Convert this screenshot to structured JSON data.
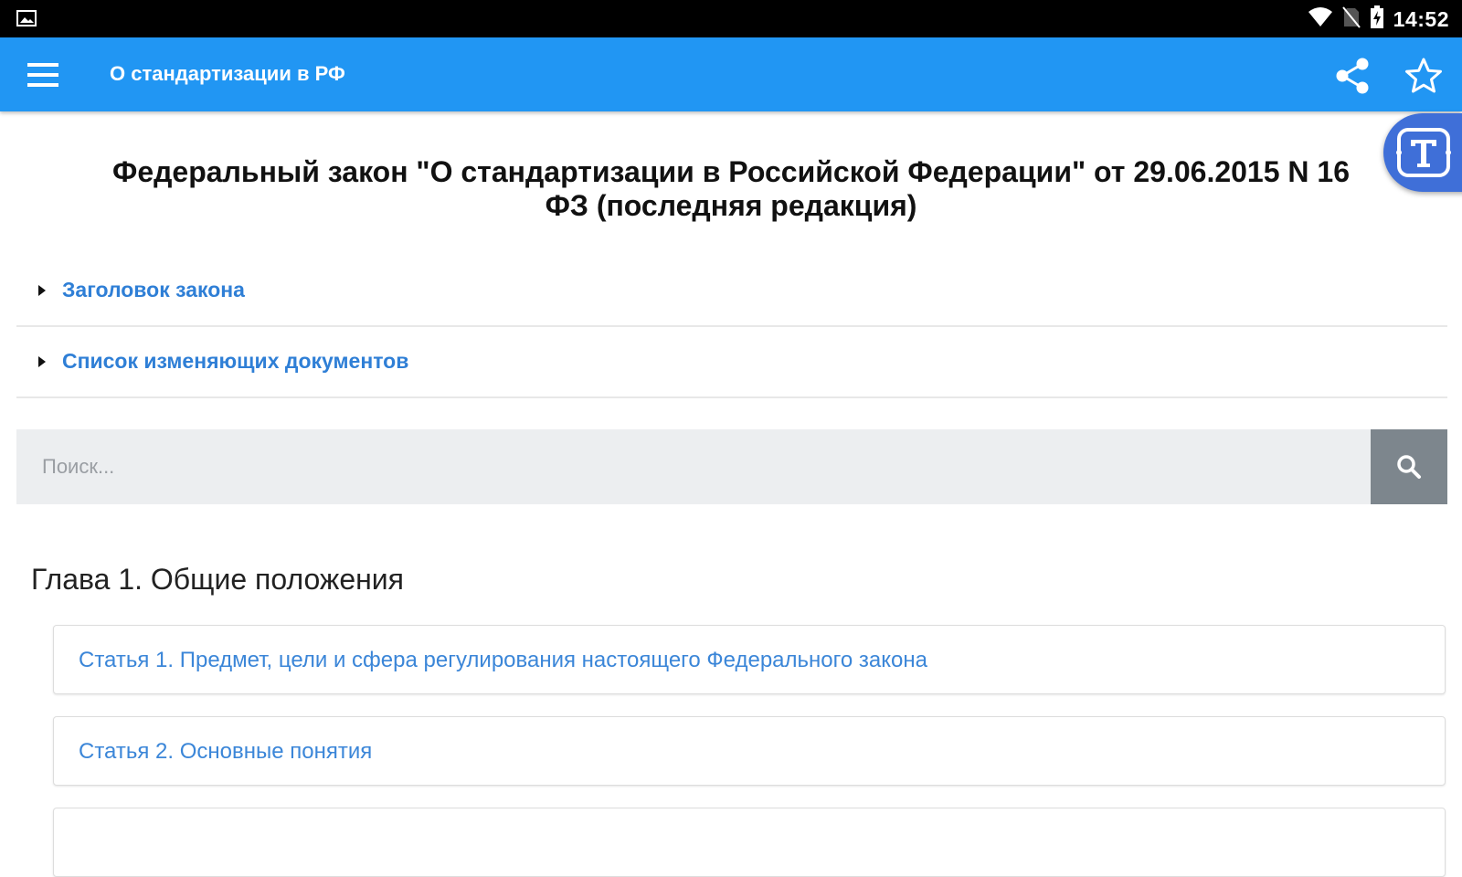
{
  "status_bar": {
    "time": "14:52",
    "icons": [
      "image-notification-icon",
      "wifi-icon",
      "no-sim-icon",
      "battery-charging-icon"
    ]
  },
  "app_bar": {
    "title": "О стандартизации в РФ",
    "icons": [
      "menu-icon",
      "share-icon",
      "star-icon"
    ]
  },
  "floating_button": {
    "icon": "translate-text-icon"
  },
  "document": {
    "title": "Федеральный закон \"О стандартизации в Российской Федерации\" от 29.06.2015 N 16\nФЗ (последняя редакция)"
  },
  "expanders": [
    {
      "label": "Заголовок закона"
    },
    {
      "label": "Список изменяющих документов"
    }
  ],
  "search": {
    "placeholder": "Поиск...",
    "icon": "search-icon"
  },
  "chapter": {
    "title": "Глава 1. Общие положения",
    "articles": [
      {
        "label": "Статья 1. Предмет, цели и сфера регулирования настоящего Федерального закона"
      },
      {
        "label": "Статья 2. Основные понятия"
      },
      {
        "label": ""
      }
    ]
  },
  "colors": {
    "app_bar": "#2196f3",
    "link": "#2f7fd6",
    "search_button": "#7d868d",
    "search_field": "#eceef0",
    "floating_button": "#3f6fd8"
  }
}
